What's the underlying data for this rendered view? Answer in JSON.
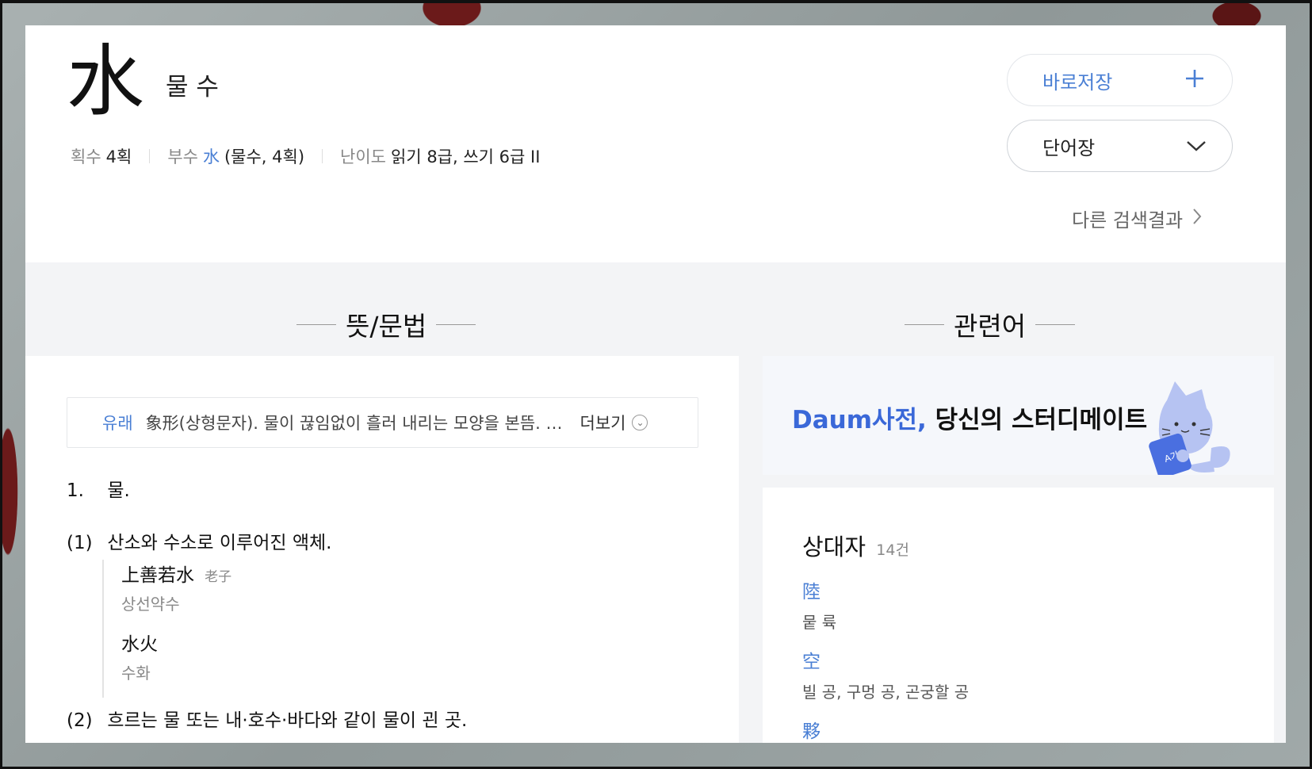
{
  "entry": {
    "hanja": "水",
    "reading": "물 수",
    "meta": {
      "strokes_label": "획수",
      "strokes_value": "4획",
      "radical_label": "부수",
      "radical_char": "水",
      "radical_detail": "(물수, 4획)",
      "level_label": "난이도",
      "level_value": "읽기 8급, 쓰기 6급 II"
    }
  },
  "actions": {
    "save_label": "바로저장",
    "save_icon": "plus-icon",
    "vocab_label": "단어장",
    "vocab_icon": "chevron-down-icon",
    "other_results": "다른 검색결과"
  },
  "sections": {
    "meaning_title": "뜻/문법",
    "related_title": "관련어"
  },
  "origin": {
    "tag": "유래",
    "text": "象形(상형문자). 물이 끊임없이 흘러 내리는 모양을 본뜸. …",
    "more": "더보기"
  },
  "definitions": {
    "d1_num": "1.",
    "d1_text": "물.",
    "s1_num": "(1)",
    "s1_text": "산소와 수소로 이루어진 액체.",
    "examples": [
      {
        "hanja": "上善若水",
        "source": "老子",
        "reading": "상선약수"
      },
      {
        "hanja": "水火",
        "source": "",
        "reading": "수화"
      }
    ],
    "s2_num": "(2)",
    "s2_text": "흐르는 물 또는 내·호수·바다와 같이 물이 괸 곳."
  },
  "banner": {
    "brand": "Daum사전,",
    "text": " 당신의 스터디메이트"
  },
  "related": {
    "heading": "상대자",
    "count": "14건",
    "items": [
      {
        "char": "陸",
        "meaning": "뭍 륙"
      },
      {
        "char": "空",
        "meaning": "빌 공, 구멍 공, 곤궁할 공"
      },
      {
        "char": "夥",
        "meaning": ""
      }
    ]
  },
  "colors": {
    "accent": "#4a7fd4",
    "brand": "#3a68d8"
  }
}
